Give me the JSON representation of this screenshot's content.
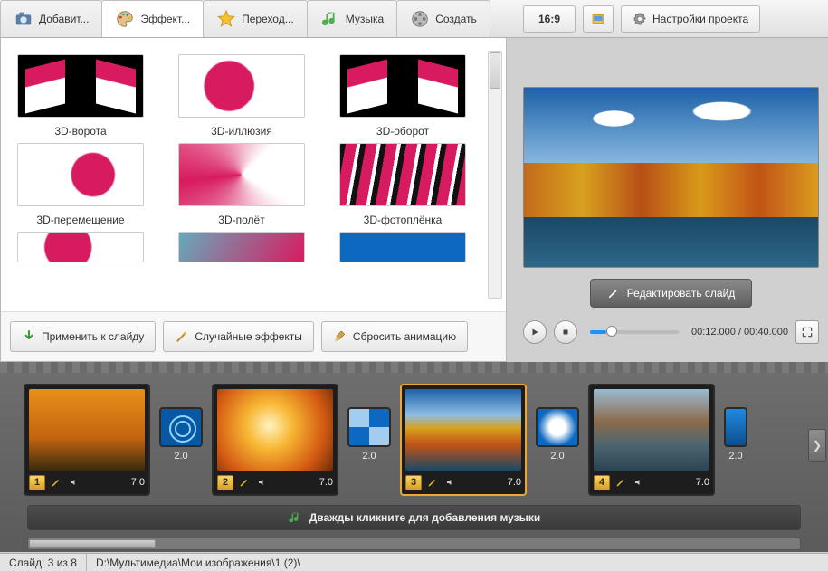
{
  "tabs": {
    "add": {
      "label": "Добавит..."
    },
    "effects": {
      "label": "Эффект..."
    },
    "trans": {
      "label": "Переход..."
    },
    "music": {
      "label": "Музыка"
    },
    "create": {
      "label": "Создать"
    }
  },
  "aspect_ratio": "16:9",
  "settings_label": "Настройки проекта",
  "effects": [
    {
      "label": "3D-ворота"
    },
    {
      "label": "3D-иллюзия"
    },
    {
      "label": "3D-оборот"
    },
    {
      "label": "3D-перемещение"
    },
    {
      "label": "3D-полёт"
    },
    {
      "label": "3D-фотоплёнка"
    }
  ],
  "actions": {
    "apply": "Применить к слайду",
    "random": "Случайные эффекты",
    "reset": "Сбросить анимацию"
  },
  "preview": {
    "edit": "Редактировать слайд",
    "time": "00:12.000 / 00:40.000"
  },
  "slides": [
    {
      "num": "1",
      "dur": "7.0"
    },
    {
      "num": "2",
      "dur": "7.0"
    },
    {
      "num": "3",
      "dur": "7.0"
    },
    {
      "num": "4",
      "dur": "7.0"
    }
  ],
  "transitions": [
    {
      "dur": "2.0"
    },
    {
      "dur": "2.0"
    },
    {
      "dur": "2.0"
    },
    {
      "dur": "2.0"
    }
  ],
  "music_hint": "Дважды кликните для добавления музыки",
  "status": {
    "slide": "Слайд: 3 из 8",
    "path": "D:\\Мультимедиа\\Мои изображения\\1 (2)\\"
  }
}
